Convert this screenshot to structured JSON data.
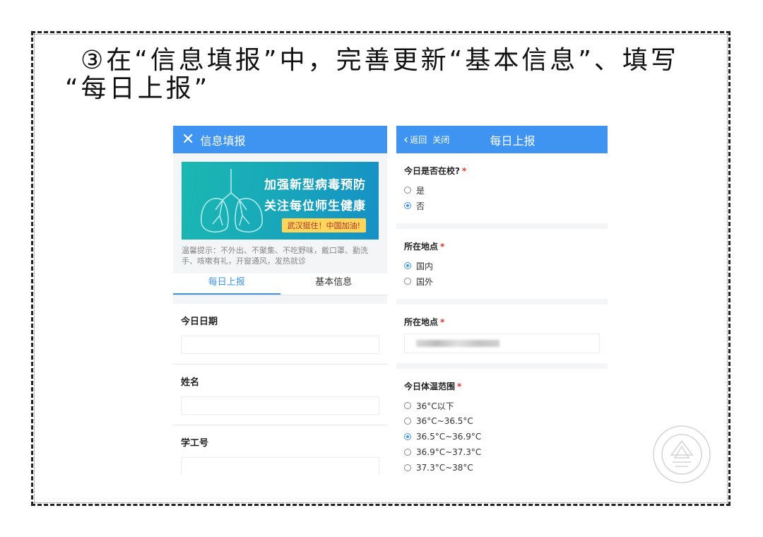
{
  "heading": {
    "line1": "③在“信息填报”中，完善更新“基本信息”、填写",
    "line2": "“每日上报”"
  },
  "left_screen": {
    "title": "信息填报",
    "banner_line1": "加强新型病毒预防",
    "banner_line2": "关注每位师生健康",
    "banner_tag": "武汉挺住！中国加油!",
    "tip": "温馨提示：不外出、不聚集、不吃野味，戴口罩、勤洗手、咳嗽有礼，开窗通风，发热就诊",
    "tabs": [
      "每日上报",
      "基本信息"
    ],
    "fields": [
      {
        "label": "今日日期",
        "value": ""
      },
      {
        "label": "姓名",
        "value": ""
      },
      {
        "label": "学工号",
        "value": ""
      }
    ]
  },
  "right_screen": {
    "back_label": "返回",
    "close_label": "关闭",
    "title": "每日上报",
    "q1": {
      "label": "今日是否在校?",
      "options": [
        "是",
        "否"
      ],
      "selected": 1
    },
    "q2": {
      "label": "所在地点",
      "options": [
        "国内",
        "国外"
      ],
      "selected": 0
    },
    "q3": {
      "label": "所在地点",
      "value": ""
    },
    "q4": {
      "label": "今日体温范围",
      "options": [
        "36°C以下",
        "36°C~36.5°C",
        "36.5°C~36.9°C",
        "36.9°C~37.3°C",
        "37.3°C~38°C"
      ],
      "selected": 2
    }
  },
  "colors": {
    "accent": "#3e94f0",
    "required": "#e0302a"
  }
}
